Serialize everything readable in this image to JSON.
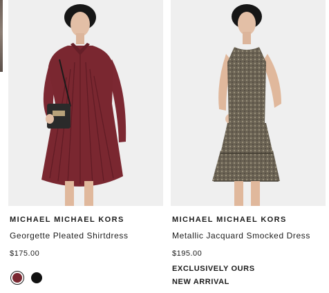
{
  "products": [
    {
      "brand": "MICHAEL MICHAEL KORS",
      "name": "Georgette Pleated Shirtdress",
      "price": "$175.00",
      "swatches": [
        {
          "color": "#7a2730",
          "selected": true
        },
        {
          "color": "#111111",
          "selected": false
        }
      ],
      "tags": []
    },
    {
      "brand": "MICHAEL MICHAEL KORS",
      "name": "Metallic Jacquard Smocked Dress",
      "price": "$195.00",
      "swatches": [],
      "tags": [
        "EXCLUSIVELY OURS",
        "NEW ARRIVAL"
      ]
    }
  ]
}
